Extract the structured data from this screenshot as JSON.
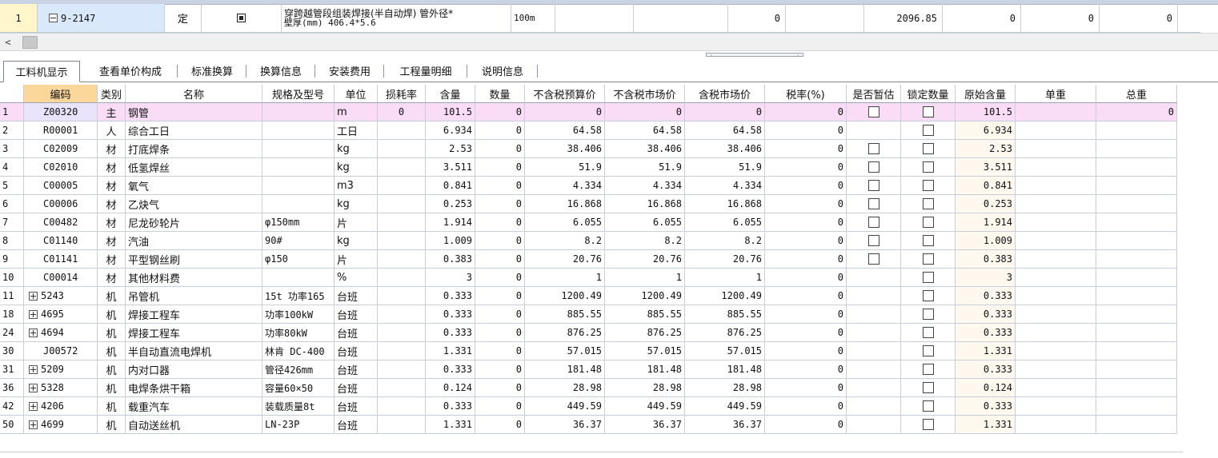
{
  "parent_row": {
    "index": "1",
    "code": "9-2147",
    "type": "定",
    "name_line1": "穿跨越管段组装焊接(半自动焊) 管外径*",
    "name_line2": "壁厚(mm) 406.4*5.6",
    "unit": "100m",
    "v1": "0",
    "v2": "2096.85",
    "v3": "0",
    "v4": "0",
    "v5": "0"
  },
  "scroll_left": "<",
  "tabs": [
    "工料机显示",
    "查看单价构成",
    "标准换算",
    "换算信息",
    "安装费用",
    "工程量明细",
    "说明信息"
  ],
  "headers": {
    "idx": "",
    "code": "编码",
    "category": "类别",
    "name": "名称",
    "spec": "规格及型号",
    "unit": "单位",
    "loss": "损耗率",
    "content": "含量",
    "qty": "数量",
    "budget_price": "不含税预算价",
    "market_price": "不含税市场价",
    "tax_market_price": "含税市场价",
    "tax_rate": "税率(%)",
    "provisional": "是否暂估",
    "lock_qty": "锁定数量",
    "orig_content": "原始含量",
    "unit_weight": "单重",
    "total_weight": "总重"
  },
  "rows": [
    {
      "idx": "1",
      "expand": "",
      "code": "Z00320",
      "category": "主",
      "name": "钢管",
      "spec": "",
      "unit": "m",
      "loss": "0",
      "content": "101.5",
      "qty": "0",
      "budget_price": "0",
      "market_price": "0",
      "tax_market_price": "0",
      "tax_rate": "0",
      "provisional": true,
      "lock_qty": true,
      "orig_content": "101.5",
      "unit_weight": "",
      "total_weight": "0"
    },
    {
      "idx": "2",
      "expand": "",
      "code": "R00001",
      "category": "人",
      "name": "综合工日",
      "spec": "",
      "unit": "工日",
      "loss": "",
      "content": "6.934",
      "qty": "0",
      "budget_price": "64.58",
      "market_price": "64.58",
      "tax_market_price": "64.58",
      "tax_rate": "0",
      "provisional": false,
      "lock_qty": true,
      "orig_content": "6.934",
      "unit_weight": "",
      "total_weight": ""
    },
    {
      "idx": "3",
      "expand": "",
      "code": "C02009",
      "category": "材",
      "name": "打底焊条",
      "spec": "",
      "unit": "kg",
      "loss": "",
      "content": "2.53",
      "qty": "0",
      "budget_price": "38.406",
      "market_price": "38.406",
      "tax_market_price": "38.406",
      "tax_rate": "0",
      "provisional": true,
      "lock_qty": true,
      "orig_content": "2.53",
      "unit_weight": "",
      "total_weight": ""
    },
    {
      "idx": "4",
      "expand": "",
      "code": "C02010",
      "category": "材",
      "name": "低氢焊丝",
      "spec": "",
      "unit": "kg",
      "loss": "",
      "content": "3.511",
      "qty": "0",
      "budget_price": "51.9",
      "market_price": "51.9",
      "tax_market_price": "51.9",
      "tax_rate": "0",
      "provisional": true,
      "lock_qty": true,
      "orig_content": "3.511",
      "unit_weight": "",
      "total_weight": ""
    },
    {
      "idx": "5",
      "expand": "",
      "code": "C00005",
      "category": "材",
      "name": "氧气",
      "spec": "",
      "unit": "m3",
      "loss": "",
      "content": "0.841",
      "qty": "0",
      "budget_price": "4.334",
      "market_price": "4.334",
      "tax_market_price": "4.334",
      "tax_rate": "0",
      "provisional": true,
      "lock_qty": true,
      "orig_content": "0.841",
      "unit_weight": "",
      "total_weight": ""
    },
    {
      "idx": "6",
      "expand": "",
      "code": "C00006",
      "category": "材",
      "name": "乙炔气",
      "spec": "",
      "unit": "kg",
      "loss": "",
      "content": "0.253",
      "qty": "0",
      "budget_price": "16.868",
      "market_price": "16.868",
      "tax_market_price": "16.868",
      "tax_rate": "0",
      "provisional": true,
      "lock_qty": true,
      "orig_content": "0.253",
      "unit_weight": "",
      "total_weight": ""
    },
    {
      "idx": "7",
      "expand": "",
      "code": "C00482",
      "category": "材",
      "name": "尼龙砂轮片",
      "spec": "φ150mm",
      "unit": "片",
      "loss": "",
      "content": "1.914",
      "qty": "0",
      "budget_price": "6.055",
      "market_price": "6.055",
      "tax_market_price": "6.055",
      "tax_rate": "0",
      "provisional": true,
      "lock_qty": true,
      "orig_content": "1.914",
      "unit_weight": "",
      "total_weight": ""
    },
    {
      "idx": "8",
      "expand": "",
      "code": "C01140",
      "category": "材",
      "name": "汽油",
      "spec": "90#",
      "unit": "kg",
      "loss": "",
      "content": "1.009",
      "qty": "0",
      "budget_price": "8.2",
      "market_price": "8.2",
      "tax_market_price": "8.2",
      "tax_rate": "0",
      "provisional": true,
      "lock_qty": true,
      "orig_content": "1.009",
      "unit_weight": "",
      "total_weight": ""
    },
    {
      "idx": "9",
      "expand": "",
      "code": "C01141",
      "category": "材",
      "name": "平型钢丝刷",
      "spec": "φ150",
      "unit": "片",
      "loss": "",
      "content": "0.383",
      "qty": "0",
      "budget_price": "20.76",
      "market_price": "20.76",
      "tax_market_price": "20.76",
      "tax_rate": "0",
      "provisional": true,
      "lock_qty": true,
      "orig_content": "0.383",
      "unit_weight": "",
      "total_weight": ""
    },
    {
      "idx": "10",
      "expand": "",
      "code": "C00014",
      "category": "材",
      "name": "其他材料费",
      "spec": "",
      "unit": "%",
      "loss": "",
      "content": "3",
      "qty": "0",
      "budget_price": "1",
      "market_price": "1",
      "tax_market_price": "1",
      "tax_rate": "0",
      "provisional": false,
      "lock_qty": true,
      "orig_content": "3",
      "unit_weight": "",
      "total_weight": ""
    },
    {
      "idx": "11",
      "expand": "+",
      "code": "5243",
      "category": "机",
      "name": "吊管机",
      "spec": "15t 功率165",
      "unit": "台班",
      "loss": "",
      "content": "0.333",
      "qty": "0",
      "budget_price": "1200.49",
      "market_price": "1200.49",
      "tax_market_price": "1200.49",
      "tax_rate": "0",
      "provisional": false,
      "lock_qty": true,
      "orig_content": "0.333",
      "unit_weight": "",
      "total_weight": ""
    },
    {
      "idx": "18",
      "expand": "+",
      "code": "4695",
      "category": "机",
      "name": "焊接工程车",
      "spec": "功率100kW",
      "unit": "台班",
      "loss": "",
      "content": "0.333",
      "qty": "0",
      "budget_price": "885.55",
      "market_price": "885.55",
      "tax_market_price": "885.55",
      "tax_rate": "0",
      "provisional": false,
      "lock_qty": true,
      "orig_content": "0.333",
      "unit_weight": "",
      "total_weight": ""
    },
    {
      "idx": "24",
      "expand": "+",
      "code": "4694",
      "category": "机",
      "name": "焊接工程车",
      "spec": "功率80kW",
      "unit": "台班",
      "loss": "",
      "content": "0.333",
      "qty": "0",
      "budget_price": "876.25",
      "market_price": "876.25",
      "tax_market_price": "876.25",
      "tax_rate": "0",
      "provisional": false,
      "lock_qty": true,
      "orig_content": "0.333",
      "unit_weight": "",
      "total_weight": ""
    },
    {
      "idx": "30",
      "expand": "",
      "code": "J00572",
      "category": "机",
      "name": "半自动直流电焊机",
      "spec": "林肯 DC-400",
      "unit": "台班",
      "loss": "",
      "content": "1.331",
      "qty": "0",
      "budget_price": "57.015",
      "market_price": "57.015",
      "tax_market_price": "57.015",
      "tax_rate": "0",
      "provisional": false,
      "lock_qty": true,
      "orig_content": "1.331",
      "unit_weight": "",
      "total_weight": ""
    },
    {
      "idx": "31",
      "expand": "+",
      "code": "5209",
      "category": "机",
      "name": "内对口器",
      "spec": "管径426mm",
      "unit": "台班",
      "loss": "",
      "content": "0.333",
      "qty": "0",
      "budget_price": "181.48",
      "market_price": "181.48",
      "tax_market_price": "181.48",
      "tax_rate": "0",
      "provisional": false,
      "lock_qty": true,
      "orig_content": "0.333",
      "unit_weight": "",
      "total_weight": ""
    },
    {
      "idx": "36",
      "expand": "+",
      "code": "5328",
      "category": "机",
      "name": "电焊条烘干箱",
      "spec": "容量60×50",
      "unit": "台班",
      "loss": "",
      "content": "0.124",
      "qty": "0",
      "budget_price": "28.98",
      "market_price": "28.98",
      "tax_market_price": "28.98",
      "tax_rate": "0",
      "provisional": false,
      "lock_qty": true,
      "orig_content": "0.124",
      "unit_weight": "",
      "total_weight": ""
    },
    {
      "idx": "42",
      "expand": "+",
      "code": "4206",
      "category": "机",
      "name": "载重汽车",
      "spec": "装载质量8t",
      "unit": "台班",
      "loss": "",
      "content": "0.333",
      "qty": "0",
      "budget_price": "449.59",
      "market_price": "449.59",
      "tax_market_price": "449.59",
      "tax_rate": "0",
      "provisional": false,
      "lock_qty": true,
      "orig_content": "0.333",
      "unit_weight": "",
      "total_weight": ""
    },
    {
      "idx": "50",
      "expand": "+",
      "code": "4699",
      "category": "机",
      "name": "自动送丝机",
      "spec": "LN-23P",
      "unit": "台班",
      "loss": "",
      "content": "1.331",
      "qty": "0",
      "budget_price": "36.37",
      "market_price": "36.37",
      "tax_market_price": "36.37",
      "tax_rate": "0",
      "provisional": false,
      "lock_qty": true,
      "orig_content": "1.331",
      "unit_weight": "",
      "total_weight": ""
    }
  ],
  "colors": {
    "selected_row": "#fbdcf6",
    "header_code": "#fcd79b",
    "parent_code_cell": "#d9e8fb",
    "parent_index_cell": "#fff6cc"
  }
}
